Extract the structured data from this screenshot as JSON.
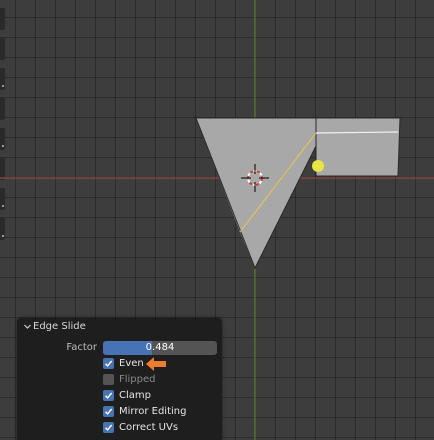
{
  "colors": {
    "accent": "#4772b3",
    "mesh_face": "#a8a8a8",
    "selected_edge": "#e8c84a",
    "vertex_highlight": "#e6e645",
    "x_axis": "#b84a4a",
    "y_axis": "#6a8f2f",
    "annotation_arrow": "#ef7d2d"
  },
  "panel": {
    "title": "Edge Slide",
    "factor_label": "Factor",
    "factor_value": "0.484",
    "factor_fraction": 0.484,
    "options": [
      {
        "label": "Even",
        "checked": true,
        "enabled": true
      },
      {
        "label": "Flipped",
        "checked": false,
        "enabled": false
      },
      {
        "label": "Clamp",
        "checked": true,
        "enabled": true
      },
      {
        "label": "Mirror Editing",
        "checked": true,
        "enabled": true
      },
      {
        "label": "Correct UVs",
        "checked": true,
        "enabled": true
      }
    ]
  },
  "icons": {
    "collapse": "chevron-down-icon",
    "cursor": "3d-cursor-icon",
    "annotation": "arrow-left-icon"
  }
}
